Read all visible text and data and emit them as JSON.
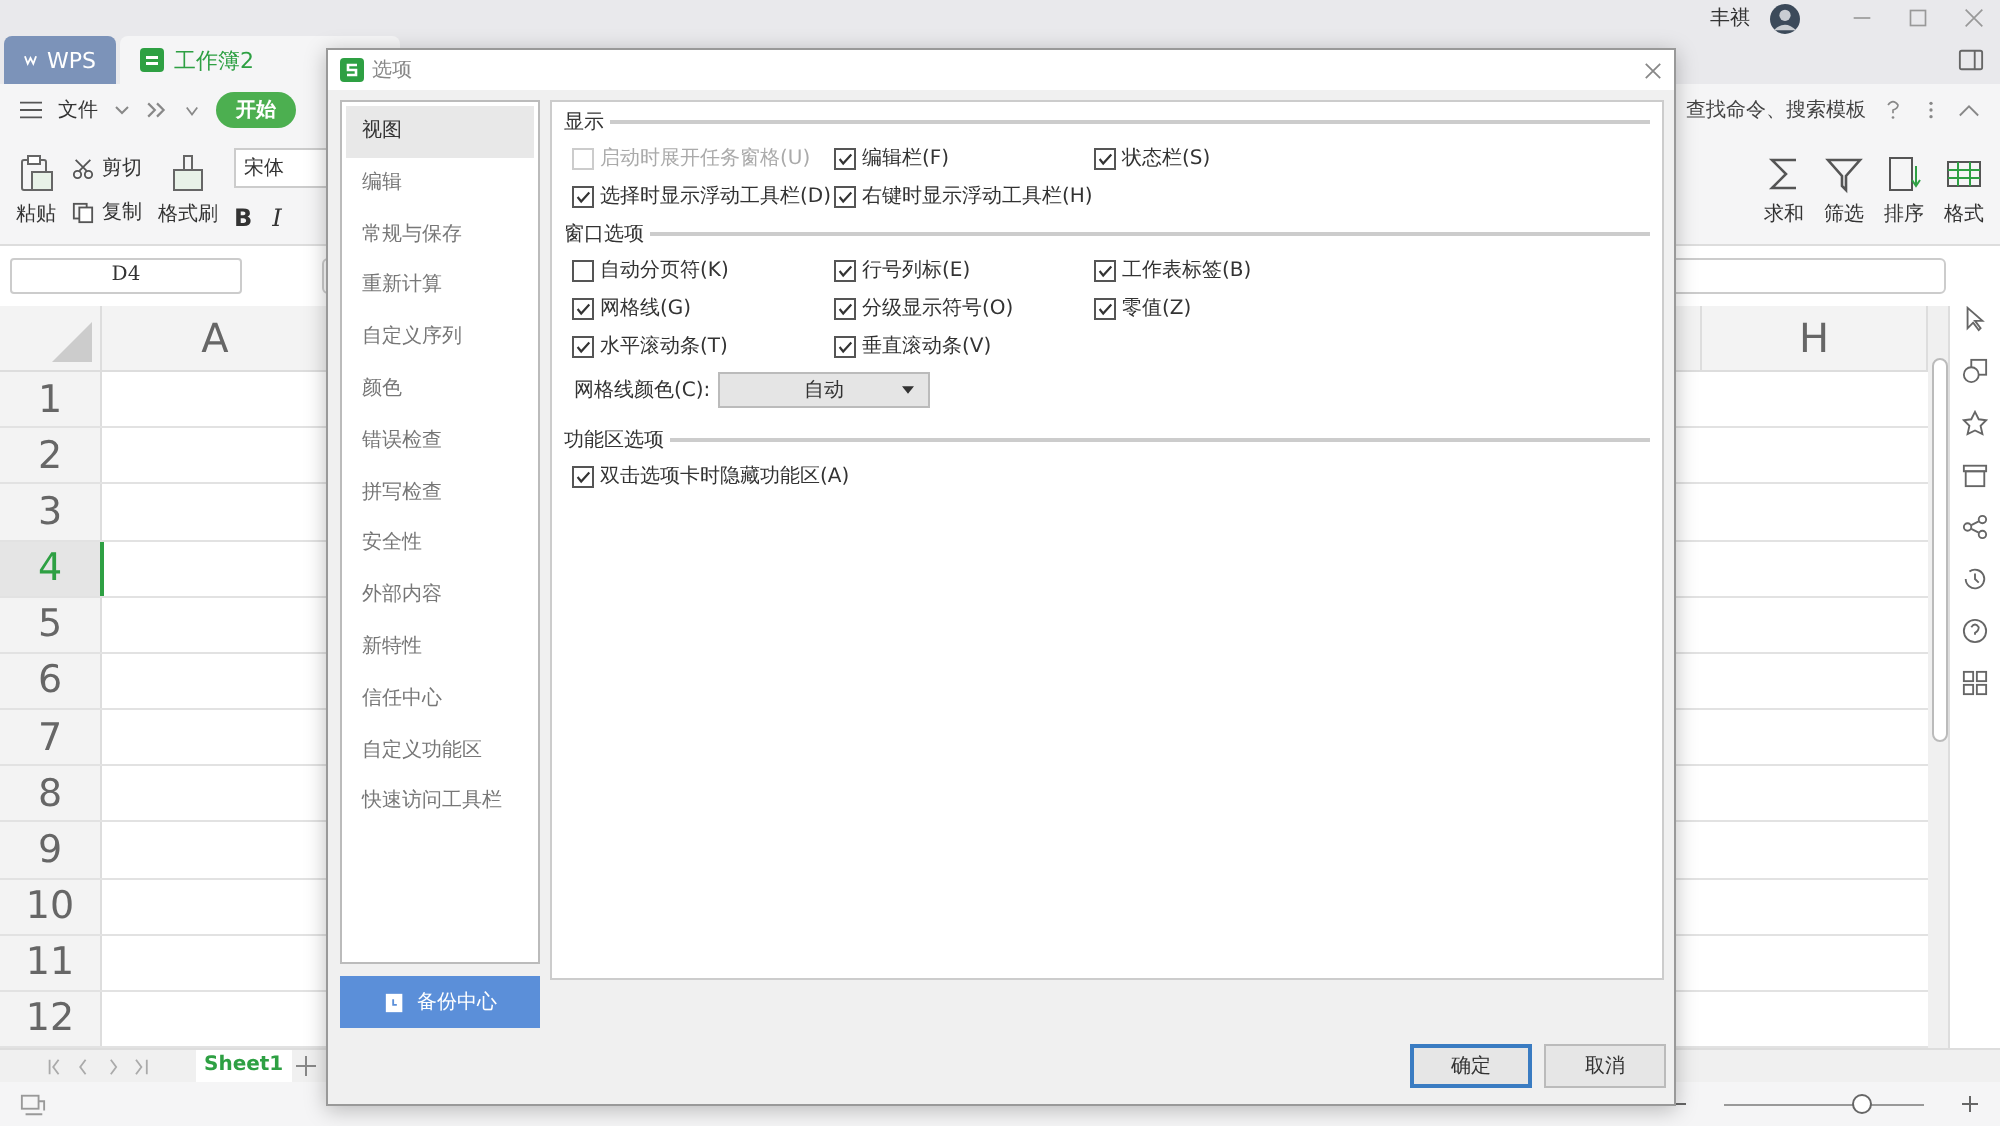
{
  "app": {
    "user_name": "丰祺",
    "tabs": [
      {
        "label": "WPS",
        "selected": false,
        "kind": "home"
      },
      {
        "label": "工作簿2",
        "selected": true,
        "kind": "doc"
      }
    ]
  },
  "menu": {
    "file": "文件",
    "active_tab": "开始",
    "search_hint": "查找命令、搜索模板"
  },
  "ribbon": {
    "paste": "粘贴",
    "cut": "剪切",
    "copy": "复制",
    "format_painter": "格式刷",
    "font": "宋体",
    "bold": "B",
    "italic": "I",
    "right_tools": [
      {
        "label": "求和",
        "kind": "sum"
      },
      {
        "label": "筛选",
        "kind": "filter"
      },
      {
        "label": "排序",
        "kind": "sort"
      },
      {
        "label": "格式",
        "kind": "format"
      }
    ]
  },
  "formula_bar": {
    "cell_ref": "D4"
  },
  "grid": {
    "columns": [
      {
        "label": "A",
        "selected": false
      },
      {
        "label": "H",
        "selected": false
      }
    ],
    "rows": [
      {
        "label": "1",
        "selected": false
      },
      {
        "label": "2",
        "selected": false
      },
      {
        "label": "3",
        "selected": false
      },
      {
        "label": "4",
        "selected": true
      },
      {
        "label": "5",
        "selected": false
      },
      {
        "label": "6",
        "selected": false
      },
      {
        "label": "7",
        "selected": false
      },
      {
        "label": "8",
        "selected": false
      },
      {
        "label": "9",
        "selected": false
      },
      {
        "label": "10",
        "selected": false
      },
      {
        "label": "11",
        "selected": false
      },
      {
        "label": "12",
        "selected": false
      }
    ]
  },
  "sheets": [
    {
      "label": "Sheet1",
      "selected": true
    }
  ],
  "status_bar": {
    "zoom": {
      "level": 0.69
    }
  },
  "dialog": {
    "title": "选项",
    "nav": [
      {
        "label": "视图",
        "selected": true
      },
      {
        "label": "编辑",
        "selected": false
      },
      {
        "label": "常规与保存",
        "selected": false
      },
      {
        "label": "重新计算",
        "selected": false
      },
      {
        "label": "自定义序列",
        "selected": false
      },
      {
        "label": "颜色",
        "selected": false
      },
      {
        "label": "错误检查",
        "selected": false
      },
      {
        "label": "拼写检查",
        "selected": false
      },
      {
        "label": "安全性",
        "selected": false
      },
      {
        "label": "外部内容",
        "selected": false
      },
      {
        "label": "新特性",
        "selected": false
      },
      {
        "label": "信任中心",
        "selected": false
      },
      {
        "label": "自定义功能区",
        "selected": false
      },
      {
        "label": "快速访问工具栏",
        "selected": false
      }
    ],
    "backup_button": "备份中心",
    "sections": [
      {
        "title": "显示",
        "options": [
          {
            "label": "启动时展开任务窗格(U)",
            "checked": false,
            "disabled": true
          },
          {
            "label": "编辑栏(F)",
            "checked": true,
            "disabled": false
          },
          {
            "label": "状态栏(S)",
            "checked": true,
            "disabled": false
          },
          {
            "label": "选择时显示浮动工具栏(D)",
            "checked": true,
            "disabled": false
          },
          {
            "label": "右键时显示浮动工具栏(H)",
            "checked": true,
            "disabled": false
          }
        ]
      },
      {
        "title": "窗口选项",
        "options": [
          {
            "label": "自动分页符(K)",
            "checked": false,
            "disabled": false
          },
          {
            "label": "行号列标(E)",
            "checked": true,
            "disabled": false
          },
          {
            "label": "工作表标签(B)",
            "checked": true,
            "disabled": false
          },
          {
            "label": "网格线(G)",
            "checked": true,
            "disabled": false
          },
          {
            "label": "分级显示符号(O)",
            "checked": true,
            "disabled": false
          },
          {
            "label": "零值(Z)",
            "checked": true,
            "disabled": false
          },
          {
            "label": "水平滚动条(T)",
            "checked": true,
            "disabled": false
          },
          {
            "label": "垂直滚动条(V)",
            "checked": true,
            "disabled": false
          }
        ],
        "select": {
          "label": "网格线颜色(C):",
          "value": "自动"
        }
      },
      {
        "title": "功能区选项",
        "options": [
          {
            "label": "双击选项卡时隐藏功能区(A)",
            "checked": true,
            "disabled": false
          }
        ]
      }
    ],
    "buttons": [
      {
        "label": "确定",
        "primary": true
      },
      {
        "label": "取消",
        "primary": false
      }
    ]
  }
}
